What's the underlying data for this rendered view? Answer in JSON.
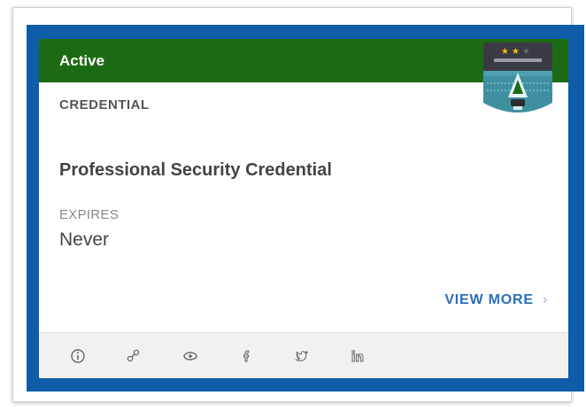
{
  "card": {
    "status": "Active",
    "type_label": "CREDENTIAL",
    "title": "Professional Security Credential",
    "expires_label": "EXPIRES",
    "expires_value": "Never",
    "view_more_label": "VIEW MORE",
    "view_more_chevron": "›"
  },
  "badge": {
    "stars_filled": 2,
    "stars_total": 3,
    "icon": "shield-badge-icon"
  },
  "footer": {
    "icons": [
      "info-icon",
      "share-icon",
      "view-icon",
      "facebook-icon",
      "twitter-icon",
      "linkedin-icon"
    ]
  },
  "colors": {
    "outer_border": "#0f5ca8",
    "header_green": "#1c6a14",
    "link_blue": "#2a6fb8",
    "badge_dark": "#3a3a44",
    "badge_teal": "#3f8fa0"
  }
}
